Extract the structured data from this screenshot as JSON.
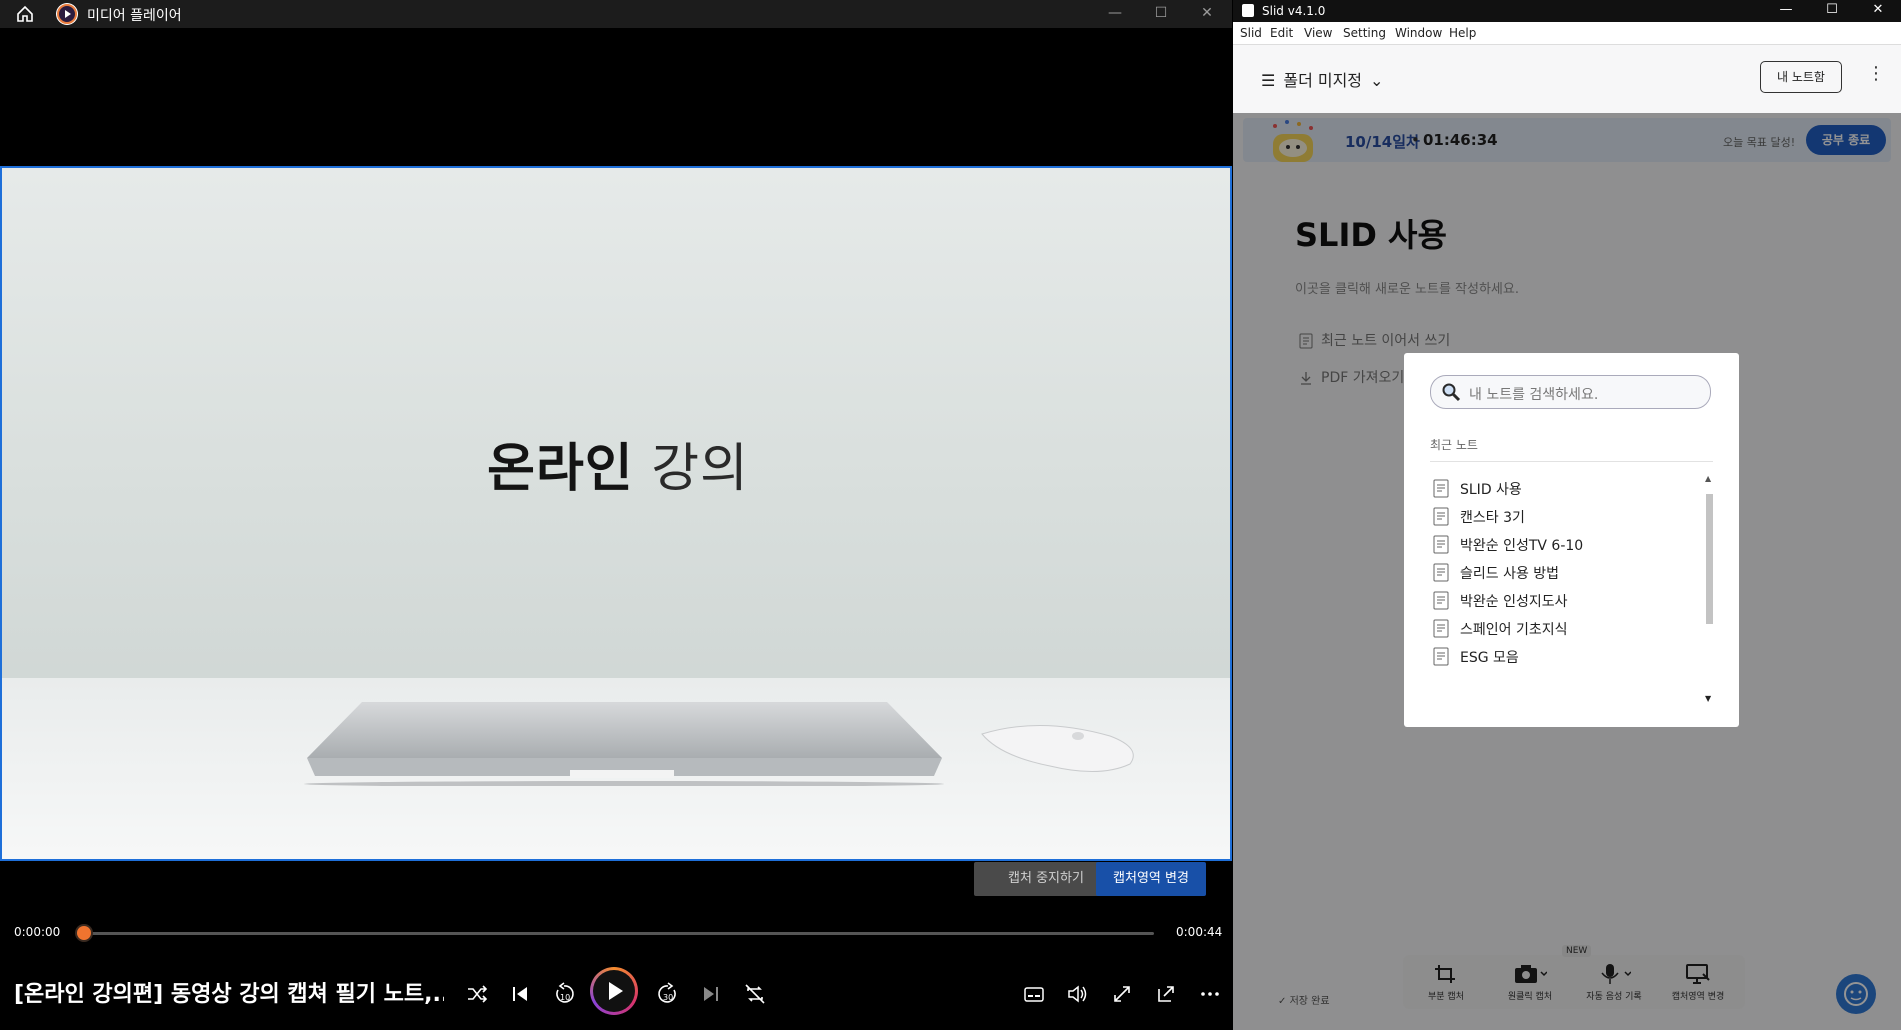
{
  "player": {
    "title": "미디어 플레이어",
    "video_text_bold": "온라인",
    "video_text_light": "강의",
    "capture_stop_label": "캡처 중지하기",
    "capture_area_label": "캡처영역 변경",
    "time_current": "0:00:00",
    "time_total": "0:00:44",
    "progress": 0.0,
    "media_title": "[온라인 강의편] 동영상 강의 캡쳐 필기 노트,..."
  },
  "slid": {
    "window_title": "Slid v4.1.0",
    "menu": [
      "Slid",
      "Edit",
      "View",
      "Setting",
      "Window",
      "Help"
    ],
    "folder": "폴더 미지정",
    "my_notes_button": "내 노트함",
    "banner": {
      "date": "10/14일차",
      "separator": "•",
      "timer": "01:46:34",
      "goal": "오늘 목표 달성!",
      "end_button": "공부 종료"
    },
    "doc": {
      "title": "SLID 사용",
      "placeholder": "이곳을 클릭해 새로운 노트를 작성하세요.",
      "option_continue": "최근 노트 이어서 쓰기",
      "option_pdf": "PDF 가져오기"
    },
    "modal": {
      "search_placeholder": "내 노트를 검색하세요.",
      "recent_label": "최근 노트",
      "notes": [
        "SLID 사용",
        "캔스타 3기",
        "박완순 인성TV 6-10",
        "슬리드 사용 방법",
        "박완순 인성지도사",
        "스페인어 기초지식",
        "ESG 모음"
      ]
    },
    "toolbar": {
      "partial_capture": "부분 캡처",
      "one_click_capture": "원클릭 캡처",
      "auto_voice": "자동 음성 기록",
      "new_badge": "NEW",
      "capture_area": "캡처영역 변경"
    },
    "save_status": "저장 완료"
  }
}
